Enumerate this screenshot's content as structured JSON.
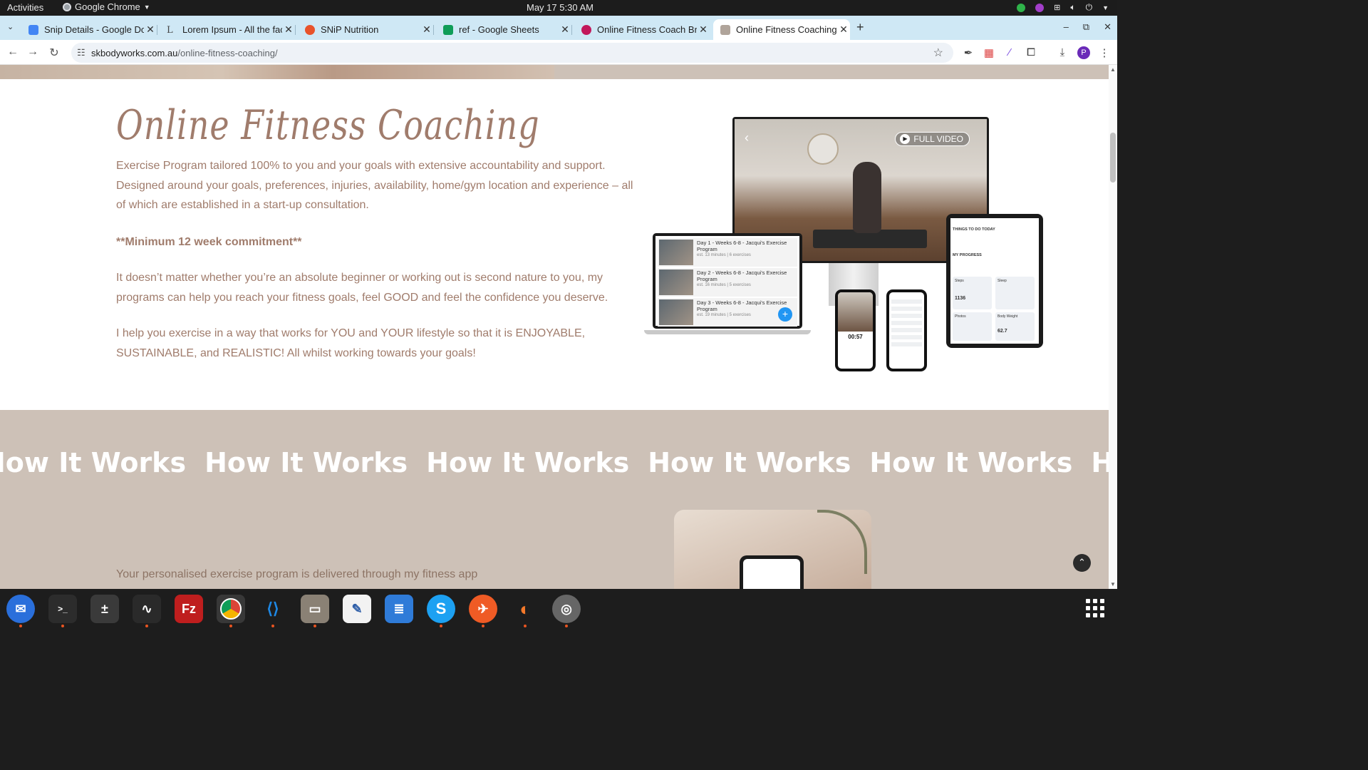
{
  "topbar": {
    "activities": "Activities",
    "app_name": "Google Chrome",
    "clock": "May 17  5:30 AM"
  },
  "tabs": [
    {
      "title": "Snip Details - Google Do",
      "favicon_color": "#4285f4"
    },
    {
      "title": "Lorem Ipsum - All the fac",
      "favicon_color": "#444444"
    },
    {
      "title": "SNiP Nutrition",
      "favicon_color": "#e8532b"
    },
    {
      "title": "ref - Google Sheets",
      "favicon_color": "#0f9d58"
    },
    {
      "title": "Online Fitness Coach Bri",
      "favicon_color": "#c2185b"
    },
    {
      "title": "Online Fitness Coaching",
      "favicon_color": "#b0a49a"
    }
  ],
  "address_bar": {
    "domain": "skbodyworks.com.au",
    "path": "/online-fitness-coaching/"
  },
  "profile_initial": "P",
  "section": {
    "heading": "Online Fitness Coaching",
    "para1": "Exercise Program tailored 100% to you and your goals with extensive accountability and support. Designed around your goals, preferences, injuries, availability, home/gym location and experience – all of which are established in a start-up consultation.",
    "commitment": "**Minimum 12 week commitment**",
    "para2": "It doesn’t matter whether you’re an absolute beginner or working out is second nature to you, my programs can help you reach your fitness goals, feel GOOD and feel the confidence you deserve.",
    "para3": "I help you exercise in a way that works for YOU and YOUR lifestyle so that it is ENJOYABLE, SUSTAINABLE, and REALISTIC! All whilst working towards your goals!"
  },
  "mockup": {
    "full_video": "FULL VIDEO",
    "laptop_rows": [
      {
        "title": "Day 1 - Weeks 6-8 - Jacqui's Exercise Program",
        "meta": "est. 13 minutes | 6 exercises"
      },
      {
        "title": "Day 2 - Weeks 6-8 - Jacqui's Exercise Program",
        "meta": "est. 16 minutes | 5 exercises"
      },
      {
        "title": "Day 3 - Weeks 6-8 - Jacqui's Exercise Program",
        "meta": "est. 19 minutes | 5 exercises"
      }
    ],
    "tablet_things": "THINGS TO DO TODAY",
    "tablet_progress": "MY PROGRESS",
    "tablet_steps": "Steps",
    "tablet_steps_value": "1136",
    "tablet_sleep": "Sleep",
    "tablet_photos": "Photos",
    "tablet_weight": "Body Weight",
    "tablet_weight_value": "62.7",
    "phone_timer": "00:57"
  },
  "how_it_works": {
    "ticker": [
      "How It Works",
      "How It Works",
      "How It Works",
      "How It Works",
      "How It Works",
      "How It Works"
    ],
    "delivery_text": "Your personalised exercise program is delivered through my fitness app"
  },
  "dock": [
    {
      "name": "thunderbird",
      "color": "#2a6fdb",
      "glyph": "✉"
    },
    {
      "name": "terminal",
      "color": "#2c2c2c",
      "glyph": ">_"
    },
    {
      "name": "calculator",
      "color": "#3a3a3a",
      "glyph": "±"
    },
    {
      "name": "system-monitor",
      "color": "#2a2a2a",
      "glyph": "∿"
    },
    {
      "name": "filezilla",
      "color": "#bf1e1e",
      "glyph": "Fz"
    },
    {
      "name": "chrome",
      "color": "#f2b600",
      "glyph": "◉"
    },
    {
      "name": "vscode",
      "color": "#1e88e5",
      "glyph": "⟨⟩"
    },
    {
      "name": "files",
      "color": "#8a8175",
      "glyph": "▭"
    },
    {
      "name": "text-editor",
      "color": "#5b8dd6",
      "glyph": "✎"
    },
    {
      "name": "libreoffice-writer",
      "color": "#2f7bd8",
      "glyph": "≣"
    },
    {
      "name": "skype",
      "color": "#1da1f2",
      "glyph": "S"
    },
    {
      "name": "postman",
      "color": "#ef5b25",
      "glyph": "✈"
    },
    {
      "name": "blender",
      "color": "#f5792a",
      "glyph": "◐"
    },
    {
      "name": "disks",
      "color": "#666666",
      "glyph": "◎"
    }
  ]
}
